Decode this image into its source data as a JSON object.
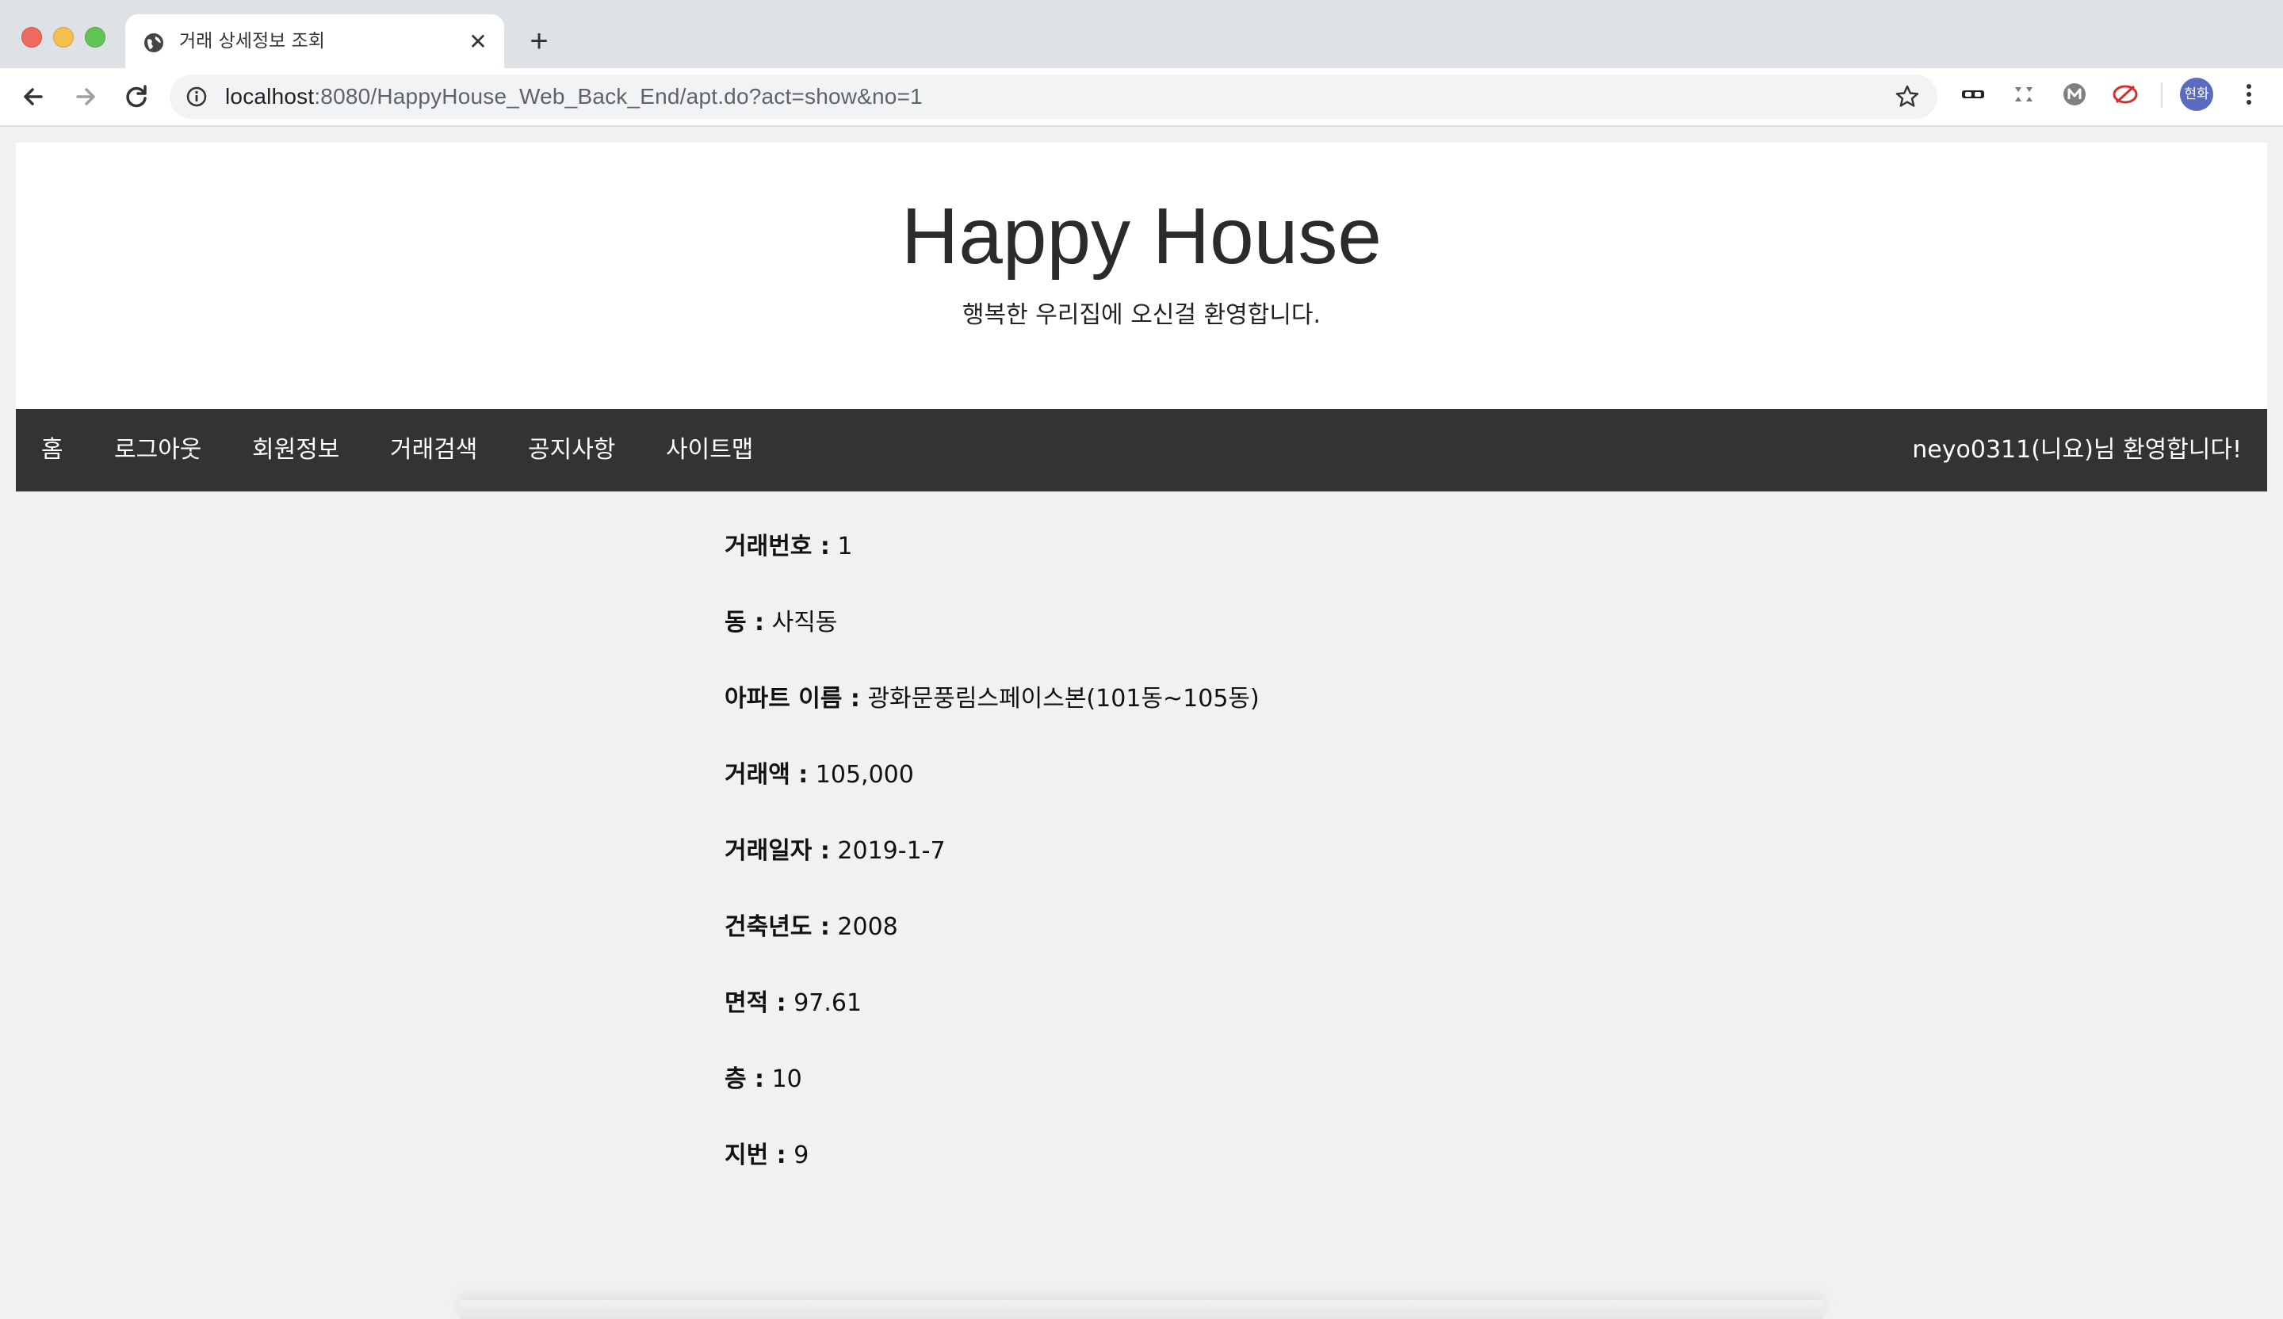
{
  "browser": {
    "tab_title": "거래 상세정보 조회",
    "url_host": "localhost",
    "url_rest": ":8080/HappyHouse_Web_Back_End/apt.do?act=show&no=1",
    "profile_label": "현화"
  },
  "header": {
    "title": "Happy House",
    "subtitle": "행복한 우리집에 오신걸 환영합니다."
  },
  "nav": {
    "items": [
      "홈",
      "로그아웃",
      "회원정보",
      "거래검색",
      "공지사항",
      "사이트맵"
    ],
    "welcome": "neyo0311(니요)님 환영합니다!"
  },
  "detail": {
    "rows": [
      {
        "label": "거래번호 :",
        "value": "1"
      },
      {
        "label": "동 :",
        "value": "사직동"
      },
      {
        "label": "아파트 이름 :",
        "value": "광화문풍림스페이스본(101동~105동)"
      },
      {
        "label": "거래액 :",
        "value": "105,000"
      },
      {
        "label": "거래일자 :",
        "value": "2019-1-7"
      },
      {
        "label": "건축년도 :",
        "value": "2008"
      },
      {
        "label": "면적 :",
        "value": "97.61"
      },
      {
        "label": "층 :",
        "value": "10"
      },
      {
        "label": "지번 :",
        "value": "9"
      }
    ]
  },
  "colors": {
    "navbar_bg": "#333333",
    "page_bg": "#f1f1f1",
    "header_bg": "#ffffff"
  }
}
